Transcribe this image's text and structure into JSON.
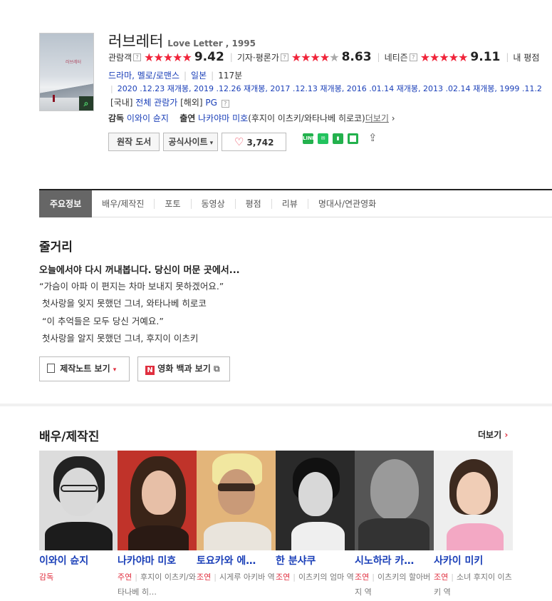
{
  "movie": {
    "title_ko": "러브레터",
    "title_en": "Love Letter , 1995"
  },
  "ratings": [
    {
      "label": "관람객",
      "stars": "★★★★★",
      "gray": "",
      "score": "9.42"
    },
    {
      "label": "기자·평론가",
      "stars": "★★★★",
      "gray": "★",
      "score": "8.63"
    },
    {
      "label": "네티즌",
      "stars": "★★★★★",
      "gray": "",
      "score": "9.11"
    },
    {
      "label": "내 평점",
      "stars": "",
      "gray": "",
      "score": ""
    }
  ],
  "help_glyph": "?",
  "genre": {
    "genres": "드라마, 멜로/로맨스",
    "country": "일본",
    "runtime": "117분"
  },
  "release": "2020 .12.23 재개봉, 2019 .12.26 재개봉, 2017 .12.13 재개봉, 2016 .01.14 재개봉, 2013 .02.14 재개봉, 1999 .11.2",
  "grade": {
    "kr_label": "[국내]",
    "kr_value": "전체 관람가",
    "intl_label": "[해외]",
    "intl_value": "PG"
  },
  "credits": {
    "director_label": "감독",
    "director": "이와이 슌지",
    "cast_label": "출연",
    "cast": "나카야마 미호",
    "cast_extra": "(후지이 이츠키/와타나베 히로코)",
    "more": "더보기"
  },
  "buttons": {
    "original_book": "원작 도서",
    "official_site": "공식사이트",
    "likes": "3,742"
  },
  "share_icons": [
    "line-icon",
    "kakao-icon",
    "bookmark-icon",
    "square-icon",
    "share-icon"
  ],
  "tabs": [
    "주요정보",
    "배우/제작진",
    "포토",
    "동영상",
    "평점",
    "리뷰",
    "명대사/연관영화"
  ],
  "synopsis": {
    "title": "줄거리",
    "headline": "오늘에서야 다시 꺼내봅니다. 당신이 머문 곳에서...",
    "lines": [
      "“가슴이 아파 이 편지는 차마 보내지 못하겠어요.”",
      "첫사랑을 잊지 못했던 그녀, 와타나베 히로코",
      "“이 추억들은 모두 당신 거예요.”",
      "첫사랑을 알지 못했던 그녀, 후지이 이츠키"
    ],
    "note_button": "제작노트 보기",
    "encyclopedia_button": "영화 백과 보기"
  },
  "cast_section": {
    "title": "배우/제작진",
    "more": "더보기",
    "people": [
      {
        "name": "이와이 슌지",
        "role_type": "감독",
        "role": ""
      },
      {
        "name": "나카야마 미호",
        "role_type": "주연",
        "role": "후지이 이츠키/와타나베 히…"
      },
      {
        "name": "토요카와 에…",
        "role_type": "조연",
        "role": "시게루 아키바 역"
      },
      {
        "name": "한 분샤쿠",
        "role_type": "조연",
        "role": "이츠키의 엄마 역"
      },
      {
        "name": "시노하라 카…",
        "role_type": "조연",
        "role": "이츠키의 할아버지 역"
      },
      {
        "name": "사카이 미키",
        "role_type": "조연",
        "role": "소녀 후지이 이츠키 역"
      }
    ]
  },
  "colors": {
    "accent_red": "#f0243a",
    "link_blue": "#1a3fb8",
    "tab_active": "#666666"
  }
}
